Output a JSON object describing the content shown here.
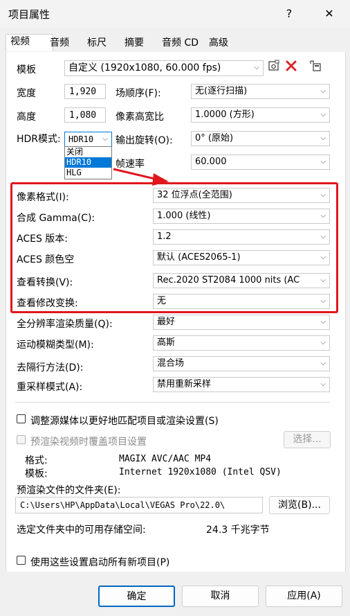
{
  "window": {
    "title": "项目属性",
    "help": "?",
    "close": "✕"
  },
  "tabs": [
    "视频",
    "音频",
    "标尺",
    "摘要",
    "音频 CD",
    "高级"
  ],
  "template": {
    "label": "模板",
    "value": "自定义 (1920x1080, 60.000 fps)"
  },
  "width": {
    "label": "宽度",
    "value": "1,920"
  },
  "height": {
    "label": "高度",
    "value": "1,080"
  },
  "field_order": {
    "label": "场顺序(F):",
    "value": "无(逐行扫描)"
  },
  "pixel_aspect": {
    "label": "像素高宽比",
    "value": "1.0000 (方形)"
  },
  "hdr_mode": {
    "label": "HDR模式:",
    "value": "HDR10",
    "options": [
      "关闭",
      "HDR10",
      "HLG"
    ]
  },
  "output_rotation": {
    "label": "输出旋转(O):",
    "value": "0° (原始)"
  },
  "frame_rate": {
    "label": "帧速率",
    "value": "60.000"
  },
  "pixel_format": {
    "label": "像素格式(I):",
    "value": "32 位浮点(全范围)"
  },
  "composite_gamma": {
    "label": "合成 Gamma(C):",
    "value": "1.000 (线性)"
  },
  "aces_version": {
    "label": "ACES 版本:",
    "value": "1.2"
  },
  "aces_colorspace": {
    "label": "ACES 颜色空",
    "value": "默认 (ACES2065-1)"
  },
  "view_transform": {
    "label": "查看转换(V):",
    "value": "Rec.2020 ST2084 1000 nits (AC"
  },
  "look_transform": {
    "label": "查看修改变换:",
    "value": "无"
  },
  "render_quality": {
    "label": "全分辨率渲染质量(Q):",
    "value": "最好"
  },
  "motion_blur": {
    "label": "运动模糊类型(M):",
    "value": "高斯"
  },
  "deinterlace": {
    "label": "去隔行方法(D):",
    "value": "混合场"
  },
  "resample": {
    "label": "重采样模式(A):",
    "value": "禁用重新采样"
  },
  "adjust_source": {
    "label": "调整源媒体以更好地匹配项目或渲染设置(S)"
  },
  "prerender_override": {
    "label": "预渲染视频时覆盖项目设置",
    "choose_label": "选择..."
  },
  "format_info": {
    "label": "格式:",
    "value": "MAGIX AVC/AAC MP4"
  },
  "template_info": {
    "label": "模板:",
    "value": "Internet 1920x1080 (Intel QSV)"
  },
  "prerender_folder": {
    "label": "预渲染文件的文件夹(E):",
    "value": "C:\\Users\\HP\\AppData\\Local\\VEGAS Pro\\22.0\\",
    "browse_label": "浏览(B)..."
  },
  "free_space": {
    "label": "选定文件夹中的可用存储空间:",
    "value": "24.3 千兆字节"
  },
  "start_new": {
    "label": "使用这些设置启动所有新项目(P)"
  },
  "buttons": {
    "ok": "确定",
    "cancel": "取消",
    "apply": "应用(A)"
  },
  "colors": {
    "highlight": "#e0161d",
    "accent": "#0078d7"
  }
}
